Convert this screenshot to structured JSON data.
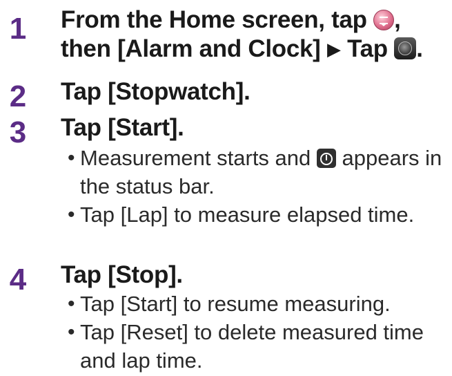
{
  "steps": [
    {
      "number": "1",
      "line1_pre": "From the Home screen, tap",
      "line1_post": ",",
      "line2_pre": "then [Alarm and Clock]",
      "arrow": "▶",
      "line2_mid": "Tap",
      "line2_post": ".",
      "icons": [
        "menu-icon",
        "alarm-clock-app-icon"
      ]
    },
    {
      "number": "2",
      "heading": "Tap [Stopwatch]."
    },
    {
      "number": "3",
      "heading": "Tap [Start].",
      "bullets": [
        {
          "pre": "Measurement starts and",
          "icon": "stopwatch-status-icon",
          "post": "appears in the status bar."
        },
        {
          "text": "Tap [Lap] to measure elapsed time."
        }
      ]
    },
    {
      "number": "4",
      "heading": "Tap [Stop].",
      "bullets": [
        {
          "text": "Tap [Start] to resume measuring."
        },
        {
          "text": "Tap [Reset] to delete measured time and lap time."
        }
      ]
    }
  ],
  "bullet_char": "•",
  "colors": {
    "step_number": "#5b2c86",
    "text": "#1a1a1a"
  }
}
